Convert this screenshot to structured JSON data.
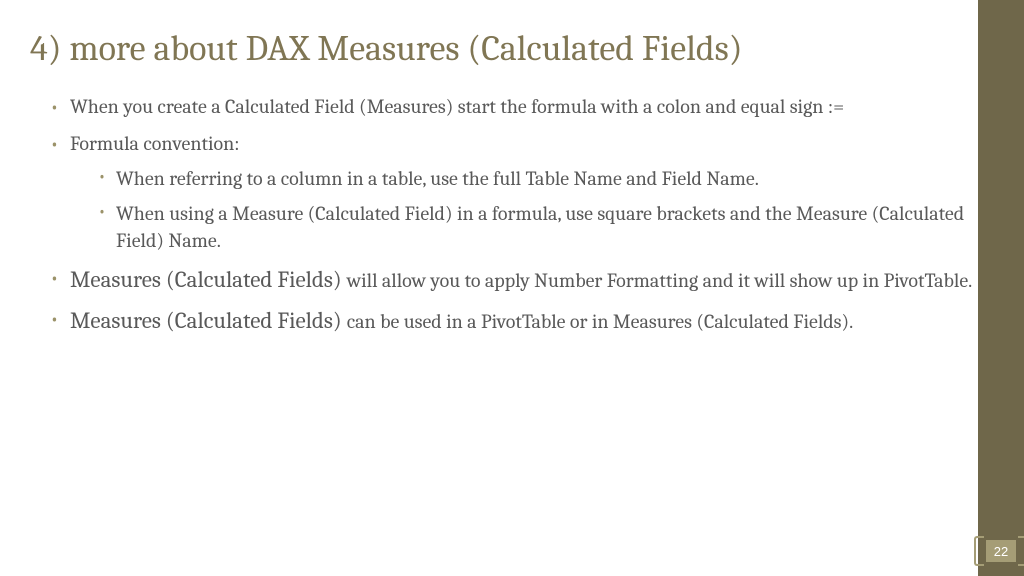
{
  "title": "4) more about DAX Measures (Calculated Fields)",
  "bullets": {
    "b1": "When you create a Calculated Field (Measures) start the formula with a colon and equal sign :=",
    "b2": "Formula convention:",
    "b2a": "When referring to a column in a table, use the full Table Name and Field Name.",
    "b2b": "When using a Measure (Calculated Field) in a formula, use square brackets and the Measure (Calculated Field) Name.",
    "b3_start": "Measures (Calculated Fields) ",
    "b3_rest": "will allow you to apply Number Formatting and it will show up in PivotTable.",
    "b4_start": "Measures (Calculated Fields) ",
    "b4_rest": "can be used in a PivotTable or in Measures (Calculated Fields)."
  },
  "page_number": "22"
}
